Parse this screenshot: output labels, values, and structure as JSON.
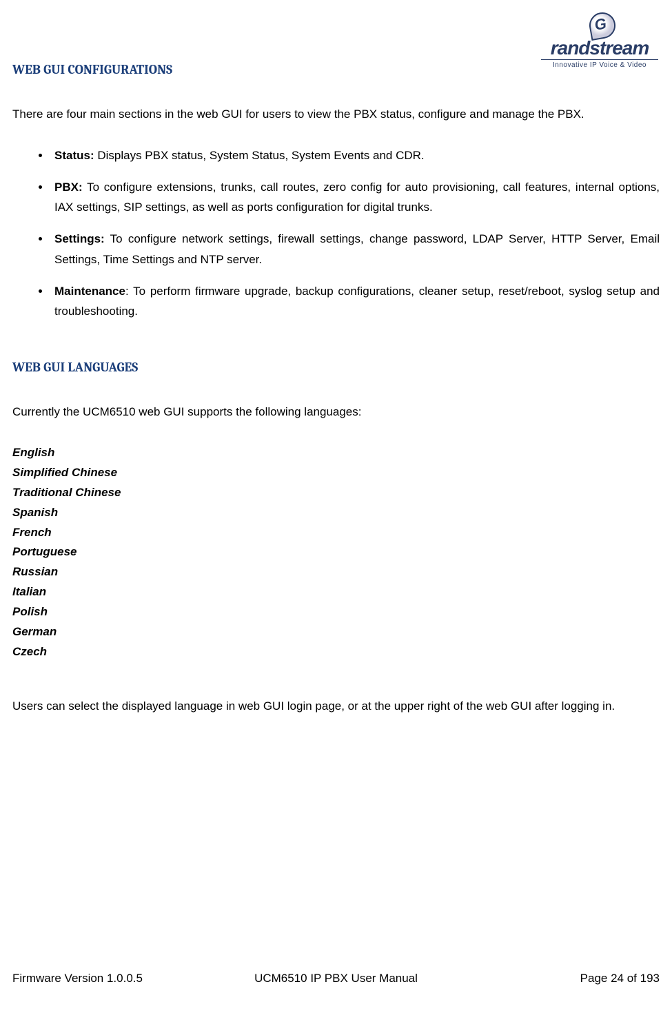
{
  "logo": {
    "brand": "randstream",
    "tagline": "Innovative IP Voice & Video"
  },
  "headings": {
    "configurations": "WEB GUI CONFIGURATIONS",
    "languages": "WEB GUI LANGUAGES"
  },
  "intro_configurations": "There are four main sections in the web GUI for users to view the PBX status, configure and manage the PBX.",
  "sections": [
    {
      "name": "Status:",
      "desc": " Displays PBX status, System Status, System Events and CDR."
    },
    {
      "name": "PBX:",
      "desc": " To configure extensions, trunks, call routes, zero config for auto provisioning, call features, internal options, IAX settings, SIP settings, as well as ports configuration for digital trunks."
    },
    {
      "name": "Settings:",
      "desc": " To configure network settings, firewall settings, change password, LDAP Server, HTTP Server, Email Settings, Time Settings and NTP server."
    },
    {
      "name": "Maintenance",
      "desc": ": To perform firmware upgrade, backup configurations, cleaner setup, reset/reboot, syslog setup and troubleshooting."
    }
  ],
  "intro_languages": "Currently the UCM6510 web GUI supports the following languages:",
  "languages": [
    "English",
    "Simplified Chinese",
    "Traditional Chinese",
    "Spanish",
    "French",
    "Portuguese",
    "Russian",
    "Italian",
    "Polish",
    "German",
    "Czech"
  ],
  "outro_languages": "Users can select the displayed language in web GUI login page, or at the upper right of the web GUI after logging in.",
  "footer": {
    "left": "Firmware Version 1.0.0.5",
    "mid": "UCM6510 IP PBX User Manual",
    "right": "Page 24 of 193"
  }
}
